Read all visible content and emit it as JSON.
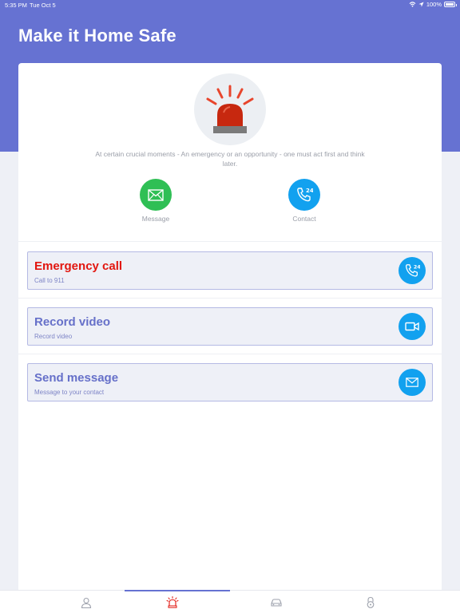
{
  "status_bar": {
    "time": "5:35 PM",
    "date": "Tue Oct 5",
    "battery": "100%"
  },
  "header": {
    "title": "Make it Home Safe"
  },
  "intro": {
    "text": "At certain crucial moments - An emergency or an opportunity - one must act first and think later."
  },
  "quick_actions": [
    {
      "label": "Message",
      "icon": "envelope-icon",
      "color": "#2fbf55"
    },
    {
      "label": "Contact",
      "icon": "phone-24-icon",
      "color": "#12a1ef"
    }
  ],
  "actions": [
    {
      "title": "Emergency call",
      "subtitle": "Call to 911",
      "icon": "phone-24-icon",
      "title_color": "#e2160f"
    },
    {
      "title": "Record video",
      "subtitle": "Record video",
      "icon": "video-camera-icon",
      "title_color": "#6670c9"
    },
    {
      "title": "Send message",
      "subtitle": "Message to your contact",
      "icon": "envelope-icon",
      "title_color": "#6670c9"
    }
  ],
  "tabbar": {
    "tabs": [
      {
        "icon": "person-icon",
        "active": false
      },
      {
        "icon": "siren-icon",
        "active": true
      },
      {
        "icon": "car-icon",
        "active": false
      },
      {
        "icon": "lock-icon",
        "active": false
      }
    ]
  },
  "colors": {
    "primary": "#6672d2",
    "accent_blue": "#12a1ef",
    "green": "#2fbf55",
    "red": "#e2160f"
  },
  "badge_24": "24"
}
